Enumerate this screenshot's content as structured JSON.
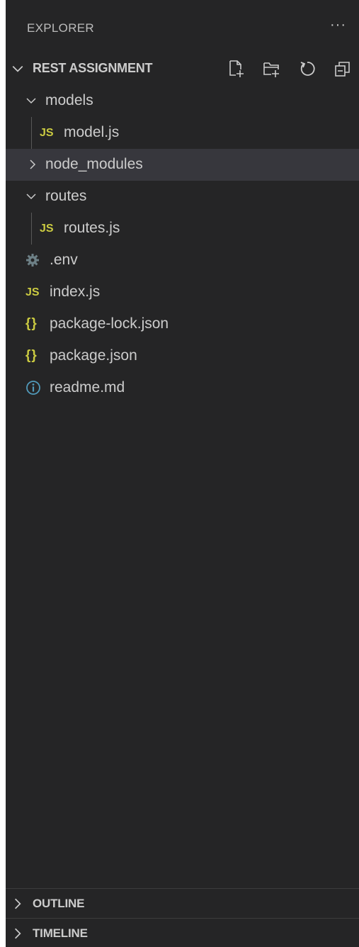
{
  "explorer": {
    "title": "EXPLORER",
    "more_label": "···"
  },
  "workspace": {
    "title": "REST ASSIGNMENT",
    "actions": [
      "new-file-icon",
      "new-folder-icon",
      "refresh-icon",
      "collapse-all-icon"
    ]
  },
  "tree": [
    {
      "label": "models",
      "kind": "folder",
      "expanded": true,
      "depth": 0
    },
    {
      "label": "model.js",
      "kind": "js",
      "depth": 1,
      "icon_text": "JS"
    },
    {
      "label": "node_modules",
      "kind": "folder",
      "expanded": false,
      "depth": 0,
      "selected": true
    },
    {
      "label": "routes",
      "kind": "folder",
      "expanded": true,
      "depth": 0
    },
    {
      "label": "routes.js",
      "kind": "js",
      "depth": 1,
      "icon_text": "JS"
    },
    {
      "label": ".env",
      "kind": "env",
      "depth": 0
    },
    {
      "label": "index.js",
      "kind": "js",
      "depth": 0,
      "icon_text": "JS"
    },
    {
      "label": "package-lock.json",
      "kind": "json",
      "depth": 0,
      "icon_text": "{}"
    },
    {
      "label": "package.json",
      "kind": "json",
      "depth": 0,
      "icon_text": "{}"
    },
    {
      "label": "readme.md",
      "kind": "info",
      "depth": 0
    }
  ],
  "outline": {
    "title": "OUTLINE"
  },
  "timeline": {
    "title": "TIMELINE"
  },
  "colors": {
    "background": "#252526",
    "selected_row": "#37373d",
    "js_icon": "#cbcb41",
    "json_icon": "#cbcb41",
    "info_icon": "#519aba",
    "env_icon": "#6d8086",
    "text": "#cccccc"
  }
}
